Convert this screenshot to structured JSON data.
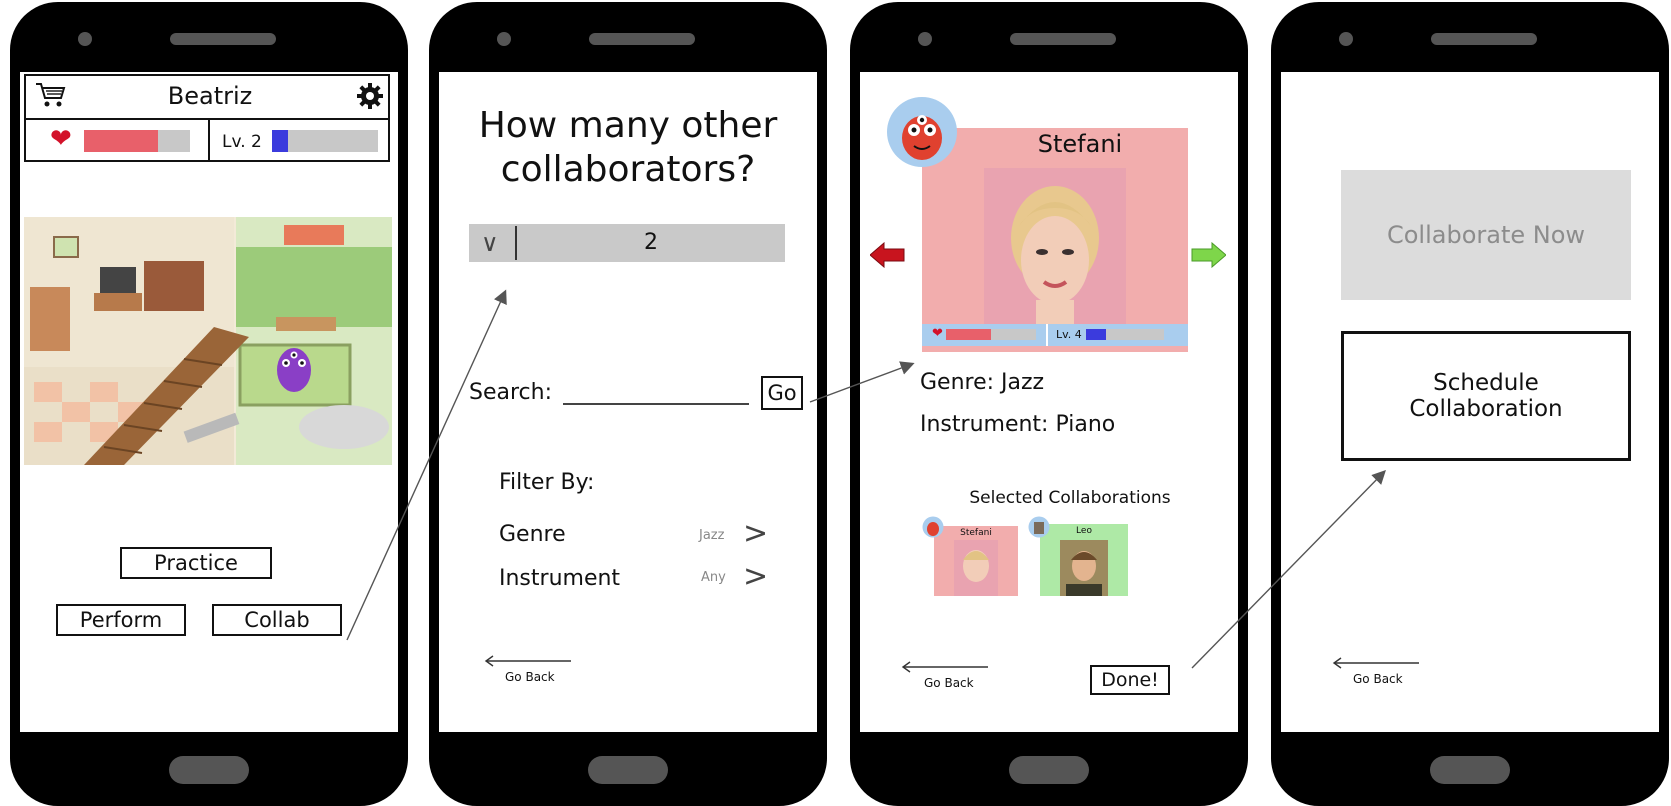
{
  "screen1": {
    "title": "Beatriz",
    "level_label": "Lv. 2",
    "health_fraction": 0.7,
    "level_fraction": 0.15,
    "buttons": {
      "practice": "Practice",
      "perform": "Perform",
      "collab": "Collab"
    },
    "colors": {
      "health": "#e8606a",
      "level": "#3b3bdd"
    }
  },
  "screen2": {
    "heading_line1": "How many other",
    "heading_line2": "collaborators?",
    "dropdown_chevron": "∨",
    "dropdown_value": "2",
    "search_label": "Search:",
    "go_label": "Go",
    "filter_label": "Filter By:",
    "filters": [
      {
        "label": "Genre",
        "value": "Jazz"
      },
      {
        "label": "Instrument",
        "value": "Any"
      }
    ],
    "back_label": "Go Back"
  },
  "screen3": {
    "name": "Stefani",
    "level_label": "Lv. 4",
    "health_fraction": 0.5,
    "level_fraction": 0.25,
    "genre": "Genre: Jazz",
    "instrument": "Instrument: Piano",
    "selected_title": "Selected Collaborations",
    "selected": [
      {
        "name": "Stefani",
        "color": "#f2adad"
      },
      {
        "name": "Leo",
        "color": "#aee9a6"
      }
    ],
    "back_label": "Go Back",
    "done_label": "Done!"
  },
  "screen4": {
    "collaborate_now": "Collaborate Now",
    "schedule_line1": "Schedule",
    "schedule_line2": "Collaboration",
    "back_label": "Go Back"
  }
}
